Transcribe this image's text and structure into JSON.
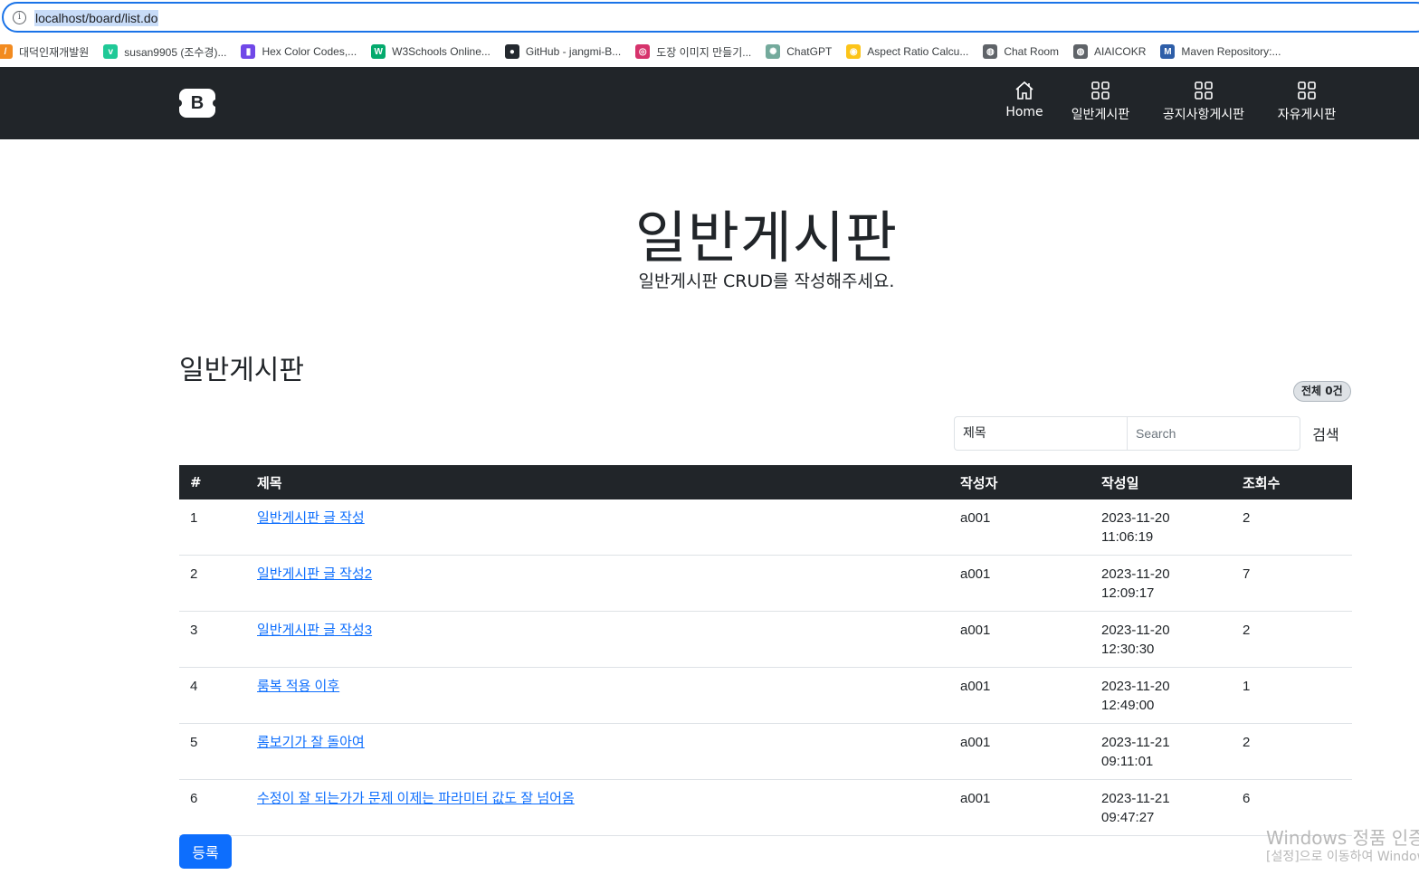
{
  "browser": {
    "url": "localhost/board/list.do",
    "bookmarks": [
      {
        "label": "대덕인재개발원",
        "icon": "dd-logo-icon",
        "color": "#f28b20"
      },
      {
        "label": "susan9905 (조수경)...",
        "icon": "velog-icon",
        "color": "#20c997"
      },
      {
        "label": "Hex Color Codes,...",
        "icon": "color-book-icon",
        "color": "#7048e8"
      },
      {
        "label": "W3Schools Online...",
        "icon": "w3schools-icon",
        "color": "#04aa6d"
      },
      {
        "label": "GitHub - jangmi-B...",
        "icon": "github-icon",
        "color": "#24292f"
      },
      {
        "label": "도장 이미지 만들기...",
        "icon": "stamp-icon",
        "color": "#d6336c"
      },
      {
        "label": "ChatGPT",
        "icon": "chatgpt-icon",
        "color": "#74aa9c"
      },
      {
        "label": "Aspect Ratio Calcu...",
        "icon": "aspect-ratio-icon",
        "color": "#fcc419"
      },
      {
        "label": "Chat Room",
        "icon": "globe-icon",
        "color": "#5f6368"
      },
      {
        "label": "AIAICOKR",
        "icon": "globe-icon",
        "color": "#5f6368"
      },
      {
        "label": "Maven Repository:...",
        "icon": "maven-icon",
        "color": "#2e5ea8"
      }
    ]
  },
  "navbar": {
    "brand": "B",
    "items": [
      {
        "label": "Home",
        "icon": "house-icon"
      },
      {
        "label": "일반게시판",
        "icon": "grid-icon"
      },
      {
        "label": "공지사항게시판",
        "icon": "grid-icon"
      },
      {
        "label": "자유게시판",
        "icon": "grid-icon"
      }
    ]
  },
  "hero": {
    "title": "일반게시판",
    "subtitle": "일반게시판 CRUD를 작성해주세요."
  },
  "board": {
    "title": "일반게시판",
    "count_badge": "전체 0건",
    "search": {
      "type_selected": "제목",
      "placeholder": "Search",
      "button_label": "검색"
    },
    "columns": [
      "#",
      "제목",
      "작성자",
      "작성일",
      "조회수"
    ],
    "rows": [
      {
        "no": "1",
        "title": "일반게시판 글 작성",
        "writer": "a001",
        "date": "2023-11-20",
        "time": "11:06:19",
        "hit": "2"
      },
      {
        "no": "2",
        "title": "일반게시판 글 작성2",
        "writer": "a001",
        "date": "2023-11-20",
        "time": "12:09:17",
        "hit": "7"
      },
      {
        "no": "3",
        "title": "일반게시판 글 작성3",
        "writer": "a001",
        "date": "2023-11-20",
        "time": "12:30:30",
        "hit": "2"
      },
      {
        "no": "4",
        "title": "룸복 적용 이후",
        "writer": "a001",
        "date": "2023-11-20",
        "time": "12:49:00",
        "hit": "1"
      },
      {
        "no": "5",
        "title": "롬보기가 잘 돌아여",
        "writer": "a001",
        "date": "2023-11-21",
        "time": "09:11:01",
        "hit": "2"
      },
      {
        "no": "6",
        "title": "수정이 잘 되는가가 문제 이제는 파라미터 값도 잘 넘어옴",
        "writer": "a001",
        "date": "2023-11-21",
        "time": "09:47:27",
        "hit": "6"
      }
    ],
    "register_label": "등록"
  },
  "watermark": {
    "line1": "Windows 정품 인증",
    "line2": "[설정]으로 이동하여 Windows"
  }
}
